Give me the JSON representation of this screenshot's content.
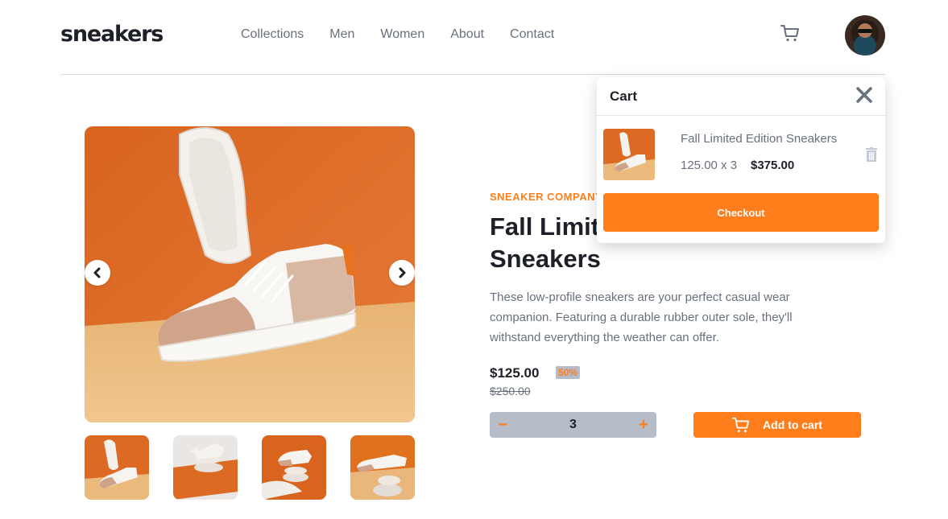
{
  "header": {
    "logo": "sneakers",
    "nav": [
      {
        "label": "Collections"
      },
      {
        "label": "Men"
      },
      {
        "label": "Women"
      },
      {
        "label": "About"
      },
      {
        "label": "Contact"
      }
    ],
    "cart_icon": "cart-icon",
    "avatar": "user-avatar"
  },
  "product": {
    "company": "SNEAKER COMPANY",
    "title": "Fall Limited Edition Sneakers",
    "description": "These low-profile sneakers are your perfect casual wear companion. Featuring a durable rubber outer sole, they'll withstand everything the weather can offer.",
    "price": "$125.00",
    "discount": "50%",
    "old_price": "$250.00",
    "quantity": "3",
    "minus": "−",
    "plus": "+",
    "add_to_cart": "Add to cart"
  },
  "gallery": {
    "prev_icon": "chevron-left-icon",
    "next_icon": "chevron-right-icon",
    "thumbnails": 4
  },
  "cart": {
    "title": "Cart",
    "close_icon": "close-icon",
    "item_name": "Fall Limited Edition Sneakers",
    "item_calc": "125.00 x 3",
    "item_total": "$375.00",
    "delete_icon": "trash-icon",
    "checkout": "Checkout"
  },
  "colors": {
    "accent": "#ff7e1b",
    "dark": "#1d2026",
    "grey_text": "#69707d",
    "qty_bg": "#b6bcc8"
  }
}
